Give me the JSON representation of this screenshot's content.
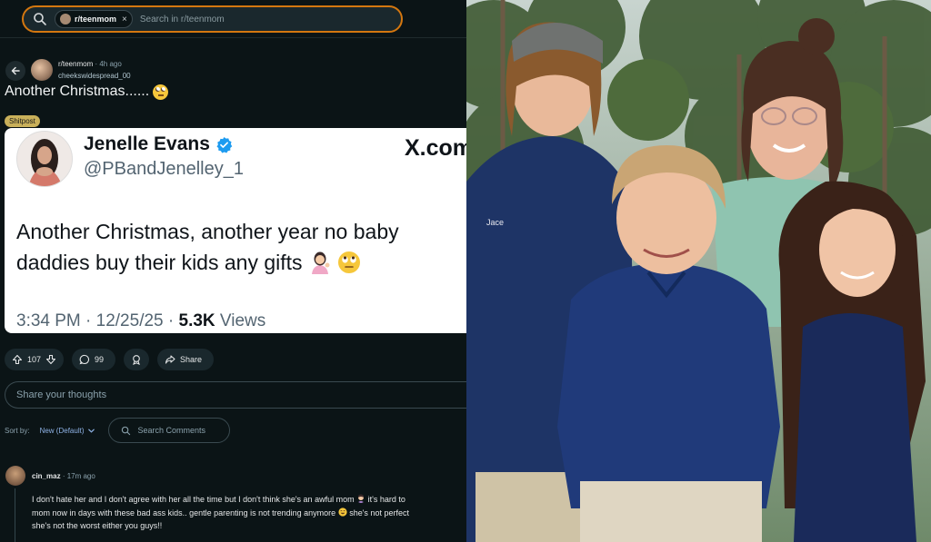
{
  "search": {
    "subreddit_chip": "r/teenmom",
    "chip_close": "×",
    "placeholder": "Search in r/teenmom"
  },
  "post": {
    "subreddit": "r/teenmom",
    "age": "· 4h ago",
    "author": "cheekswidespread_00",
    "title": "Another Christmas......",
    "flair": "Shitpost",
    "votes": "107",
    "comments": "99",
    "share_label": "Share"
  },
  "tweet": {
    "name": "Jenelle Evans",
    "handle": "@PBandJenelley_1",
    "brand": "X.com",
    "body_line1": "Another Christmas, another year no baby",
    "body_line2": "daddies buy their kids any gifts",
    "time": "3:34 PM · 12/25/25 · ",
    "views_count": "5.3K",
    "views_label": " Views"
  },
  "composer": {
    "placeholder": "Share your thoughts"
  },
  "sort": {
    "label": "Sort by:",
    "value": "New (Default)",
    "search_comments": "Search Comments"
  },
  "comment": {
    "user": "cin_maz",
    "age": "· 17m ago",
    "line1a": "I don't hate her and I don't agree with her all the time but I don't think she's an awful mom",
    "line1b": " it's hard to",
    "line2a": "mom now in days with these bad ass kids.. gentle parenting is not trending anymore",
    "line2b": " she's not perfect",
    "line3": "she's not the worst either you guys!!"
  },
  "photo": {
    "name_tag": "Jace"
  },
  "colors": {
    "background": "#0b1416",
    "search_outline": "#d4770f",
    "flair_bg": "#c9b05a",
    "verified_blue": "#1d9bf0",
    "sort_value": "#8fb3e6"
  },
  "icons": [
    "search-icon",
    "back-arrow-icon",
    "upvote-icon",
    "downvote-icon",
    "comment-icon",
    "award-icon",
    "share-icon",
    "chevron-down-icon",
    "verified-badge-icon"
  ]
}
